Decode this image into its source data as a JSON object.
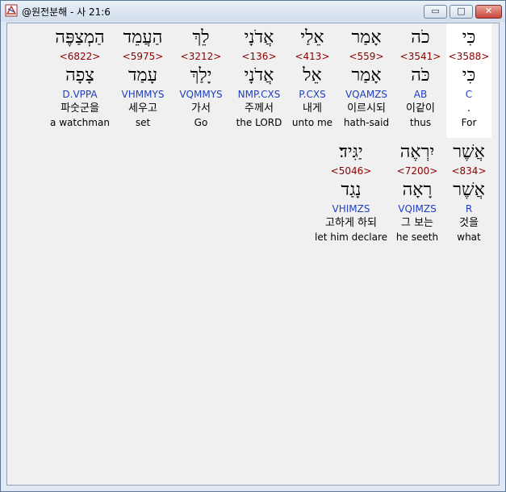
{
  "window": {
    "title": "@원전분해 - 사 21:6",
    "min_glyph": "▭",
    "max_glyph": "□",
    "close_glyph": "✕"
  },
  "row1": [
    {
      "hebrew": "כִּי",
      "strong": "<3588>",
      "lemma": "כִּי",
      "morph": "C",
      "korean": ".",
      "english": "For"
    },
    {
      "hebrew": "כֹה",
      "strong": "<3541>",
      "lemma": "כֹּה",
      "morph": "AB",
      "korean": "이같이",
      "english": "thus"
    },
    {
      "hebrew": "אָמַר",
      "strong": "<559>",
      "lemma": "אָמַר",
      "morph": "VQAMZS",
      "korean": "이르시되",
      "english": "hath-said"
    },
    {
      "hebrew": "אֵלַי",
      "strong": "<413>",
      "lemma": "אֵל",
      "morph": "P.CXS",
      "korean": "내게",
      "english": "unto me"
    },
    {
      "hebrew": "אֲדֹנָי",
      "strong": "<136>",
      "lemma": "אֲדֹנָי",
      "morph": "NMP.CXS",
      "korean": "주께서",
      "english": "the LORD"
    },
    {
      "hebrew": "לֵךְ",
      "strong": "<3212>",
      "lemma": "יָלַךְ",
      "morph": "VQMMYS",
      "korean": "가서",
      "english": "Go"
    },
    {
      "hebrew": "הַעֲמֵד",
      "strong": "<5975>",
      "lemma": "עָמַד",
      "morph": "VHMMYS",
      "korean": "세우고",
      "english": "set"
    },
    {
      "hebrew": "הַמְצַפֶּה",
      "strong": "<6822>",
      "lemma": "צָפָה",
      "morph": "D.VPPA",
      "korean": "파숫군을",
      "english": "a watchman"
    }
  ],
  "row2": [
    {
      "hebrew": "אֲשֶׁר",
      "strong": "<834>",
      "lemma": "אֲשֶׁר",
      "morph": "R",
      "korean": "것을",
      "english": "what"
    },
    {
      "hebrew": "יִרְאֶה",
      "strong": "<7200>",
      "lemma": "רָאָה",
      "morph": "VQIMZS",
      "korean": "그 보는",
      "english": "he seeth"
    },
    {
      "hebrew": "יַגִּיד׃",
      "strong": "<5046>",
      "lemma": "נָגַד",
      "morph": "VHIMZS",
      "korean": "고하게 하되",
      "english": "let him declare"
    }
  ],
  "colors": {
    "strong": "#8b0000",
    "morph": "#1f3fbf",
    "highlight": "#ffffff"
  }
}
